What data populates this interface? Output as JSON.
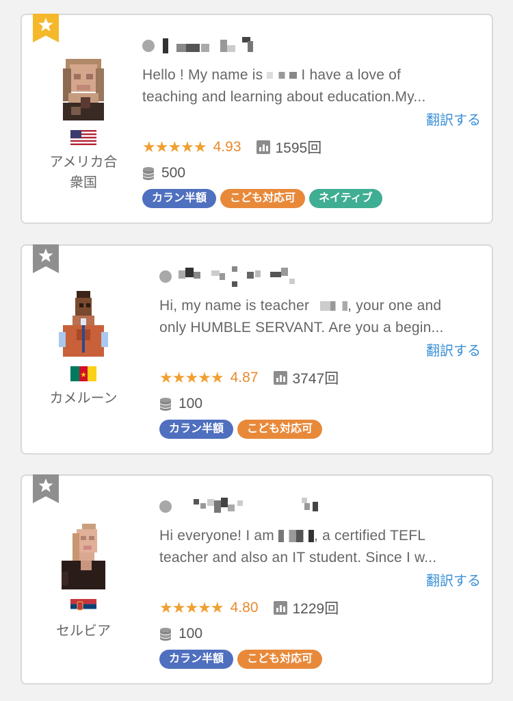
{
  "colors": {
    "star_active": "#f5b82b",
    "star_inactive": "#8f8f8f",
    "rating": "#e88a2e",
    "link": "#3a8fd6",
    "tag_callan": "#4f6fbf",
    "tag_kids": "#e8893a",
    "tag_native": "#3fae92"
  },
  "translate_label": "翻訳する",
  "teachers": [
    {
      "favorite": true,
      "country": "アメリカ合\n衆国",
      "intro_line1": "Hello ! My name is ",
      "intro_line1b": " I have a love of",
      "intro_line2": "teaching and learning about education.My...",
      "stars": "★★★★★",
      "rating": "4.93",
      "lessons": "1595回",
      "points": "500",
      "tags": [
        "カラン半額",
        "こども対応可",
        "ネイティブ"
      ]
    },
    {
      "favorite": false,
      "country": "カメルーン",
      "intro_line1": "Hi, my name is teacher ",
      "intro_line1b": ", your one and",
      "intro_line2": "only HUMBLE SERVANT. Are you a begin...",
      "stars": "★★★★★",
      "rating": "4.87",
      "lessons": "3747回",
      "points": "100",
      "tags": [
        "カラン半額",
        "こども対応可"
      ]
    },
    {
      "favorite": false,
      "country": "セルビア",
      "intro_line1": "Hi everyone! I am ",
      "intro_line1b": ", a certified TEFL",
      "intro_line2": "teacher and also an IT student. Since I w...",
      "stars": "★★★★★",
      "rating": "4.80",
      "lessons": "1229回",
      "points": "100",
      "tags": [
        "カラン半額",
        "こども対応可"
      ]
    }
  ]
}
